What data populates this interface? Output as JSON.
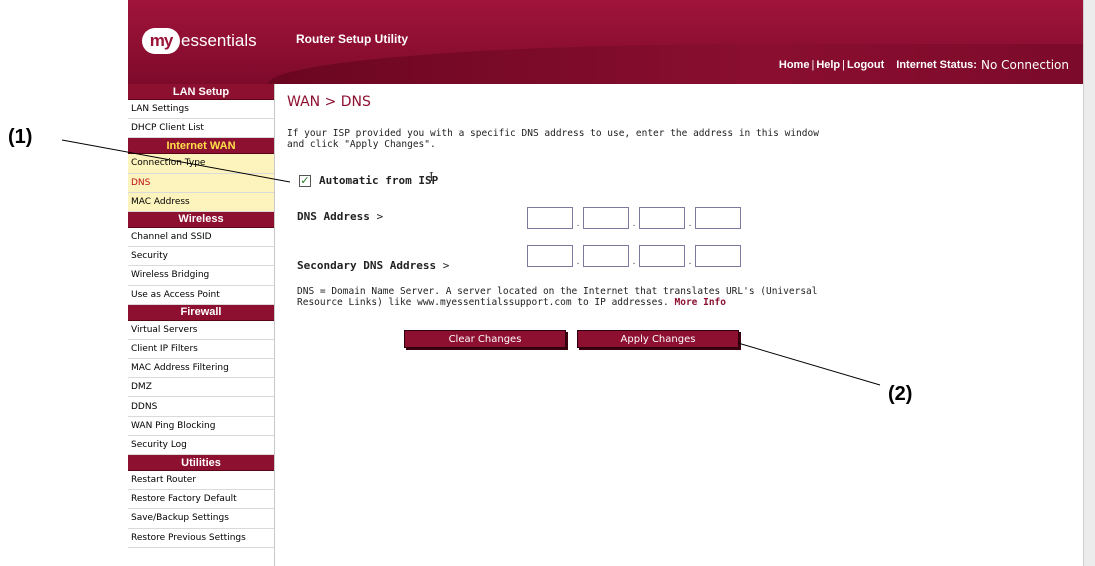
{
  "header": {
    "logo_my": "my",
    "logo_text": "essentials",
    "title": "Router Setup Utility",
    "nav": {
      "home": "Home",
      "help": "Help",
      "logout": "Logout",
      "sep": "|"
    },
    "status_label": "Internet Status:",
    "status_value": "No Connection"
  },
  "sidebar": {
    "lan": {
      "title": "LAN Setup",
      "items": [
        "LAN Settings",
        "DHCP Client List"
      ]
    },
    "wan": {
      "title": "Internet WAN",
      "items": [
        "Connection Type",
        "DNS",
        "MAC Address"
      ]
    },
    "wireless": {
      "title": "Wireless",
      "items": [
        "Channel and SSID",
        "Security",
        "Wireless Bridging",
        "Use as Access Point"
      ]
    },
    "firewall": {
      "title": "Firewall",
      "items": [
        "Virtual Servers",
        "Client IP Filters",
        "MAC Address Filtering",
        "DMZ",
        "DDNS",
        "WAN Ping Blocking",
        "Security Log"
      ]
    },
    "utilities": {
      "title": "Utilities",
      "items": [
        "Restart Router",
        "Restore Factory Default",
        "Save/Backup Settings",
        "Restore Previous Settings"
      ]
    }
  },
  "main": {
    "breadcrumb": "WAN > DNS",
    "intro_line1": "If your ISP provided you with a specific DNS address to use, enter the address in this window",
    "intro_line2": "and click \"Apply Changes\".",
    "auto_label": "Automatic from ISP",
    "auto_checked": true,
    "dns_label": "DNS Address",
    "secondary_label": "Secondary DNS Address",
    "gt": ">",
    "dot": ".",
    "note_line1": "DNS = Domain Name Server. A server located on the Internet that translates URL's (Universal",
    "note_line2": "Resource Links) like www.myessentialssupport.com to IP addresses.",
    "more_info": "More Info",
    "clear_button": "Clear Changes",
    "apply_button": "Apply Changes"
  },
  "callouts": {
    "one": "(1)",
    "two": "(2)"
  },
  "colors": {
    "brand": "#8e1030",
    "highlight": "#fcf3bd",
    "active_text": "#c01010"
  }
}
